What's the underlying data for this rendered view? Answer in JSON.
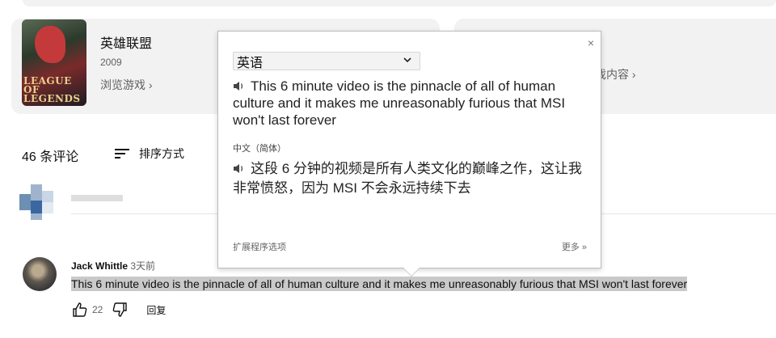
{
  "game": {
    "name": "英雄联盟",
    "year": "2009",
    "browse_label": "浏览游戏 ›",
    "logo_line1": "LEAGUE OF",
    "logo_line2": "LEGENDS"
  },
  "game2": {
    "browse_label": "戏内容 ›"
  },
  "comments": {
    "count_label": "46 条评论",
    "sort_label": "排序方式"
  },
  "comment": {
    "author": "Jack Whittle",
    "time": "3天前",
    "text": "This 6 minute video is the pinnacle of all of human culture and it makes me unreasonably furious that MSI won't last forever",
    "likes": "22",
    "reply_label": "回复"
  },
  "popup": {
    "close": "×",
    "source_lang": "英语",
    "original_text": "This 6 minute video is the pinnacle of all of human culture and it makes me unreasonably furious that MSI won't last forever",
    "target_lang": "中文（简体）",
    "translated_text": "这段 6 分钟的视频是所有人类文化的巅峰之作，这让我非常愤怒，因为 MSI 不会永远持续下去",
    "ext_options": "扩展程序选项",
    "more": "更多 »"
  },
  "colors": {
    "bg": "#ffffff",
    "card": "#f2f2f2",
    "highlight": "#c9c9c9",
    "secondary_text": "#606060"
  },
  "icons": [
    "speaker-icon",
    "sort-icon",
    "thumbs-up-icon",
    "thumbs-down-icon",
    "close-icon",
    "chevron-down-icon"
  ]
}
